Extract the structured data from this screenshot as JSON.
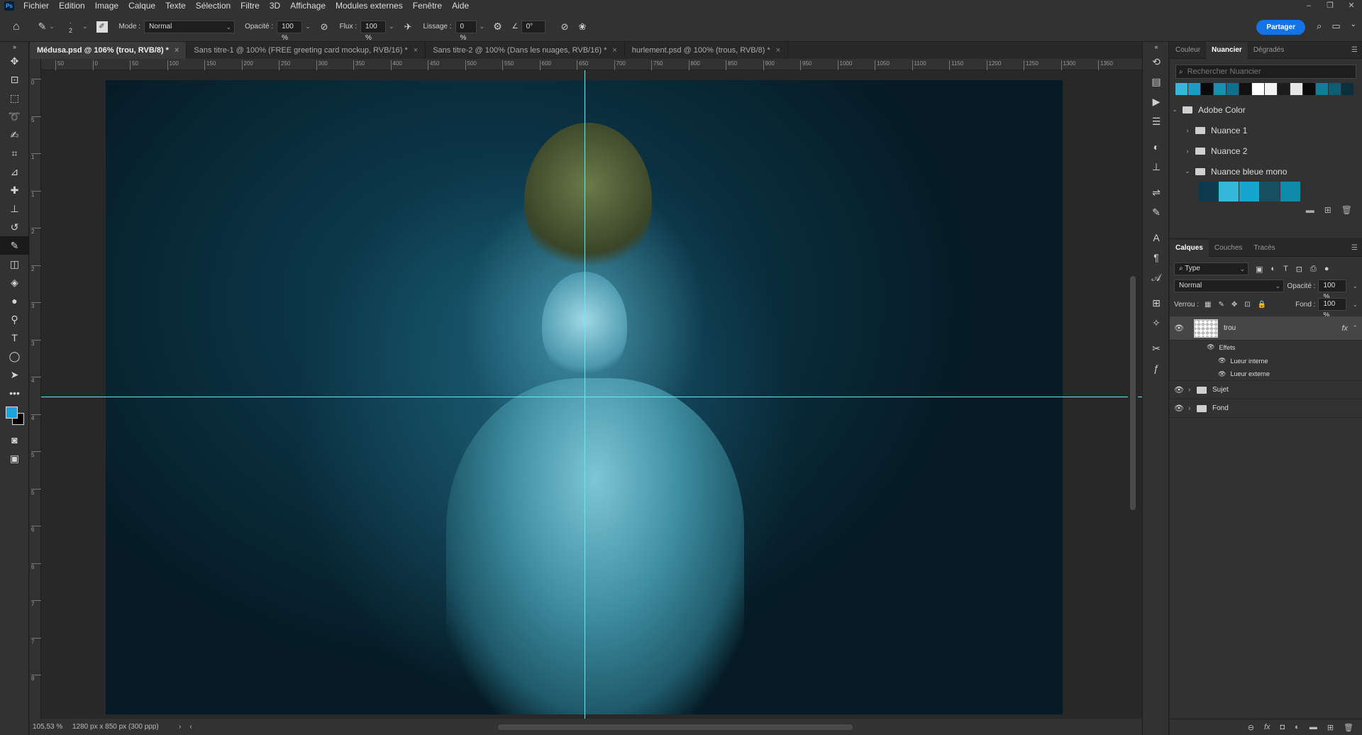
{
  "menu": [
    "Fichier",
    "Edition",
    "Image",
    "Calque",
    "Texte",
    "Sélection",
    "Filtre",
    "3D",
    "Affichage",
    "Modules externes",
    "Fenêtre",
    "Aide"
  ],
  "app_logo": "Ps",
  "options": {
    "brush_size": "2",
    "mode_label": "Mode :",
    "mode_value": "Normal",
    "opacity_label": "Opacité :",
    "opacity_value": "100 %",
    "flow_label": "Flux :",
    "flow_value": "100 %",
    "smoothing_label": "Lissage :",
    "smoothing_value": "0 %",
    "angle_value": "0°",
    "share_label": "Partager"
  },
  "tabs": [
    {
      "label": "Médusa.psd @ 106% (trou, RVB/8) *",
      "active": true
    },
    {
      "label": "Sans titre-1 @ 100% (FREE greeting card mockup, RVB/16) *",
      "active": false
    },
    {
      "label": "Sans titre-2 @ 100% (Dans les nuages, RVB/16) *",
      "active": false
    },
    {
      "label": "hurlement.psd @ 100% (trous, RVB/8) *",
      "active": false
    }
  ],
  "ruler_h": [
    "50",
    "0",
    "50",
    "100",
    "150",
    "200",
    "250",
    "300",
    "350",
    "400",
    "450",
    "500",
    "550",
    "600",
    "650",
    "700",
    "750",
    "800",
    "850",
    "900",
    "950",
    "1000",
    "1050",
    "1100",
    "1150",
    "1200",
    "1250",
    "1300",
    "1350"
  ],
  "ruler_v": [
    "0",
    "5",
    "1",
    "1",
    "2",
    "2",
    "3",
    "3",
    "4",
    "4",
    "5",
    "5",
    "6",
    "6",
    "7",
    "7",
    "8"
  ],
  "status": {
    "zoom": "105,53 %",
    "doc_info": "1280 px x 850 px (300 ppp)"
  },
  "swatch_panel": {
    "tabs": [
      "Couleur",
      "Nuancier",
      "Dégradés"
    ],
    "active_tab": "Nuancier",
    "search_placeholder": "Rechercher Nuancier",
    "recent_colors": [
      "#36b6d8",
      "#1c9cc4",
      "#0a0a0a",
      "#178fae",
      "#0f6f8c",
      "#111111",
      "#ffffff",
      "#f3f3f3",
      "#1c1c1c",
      "#e6e6e6",
      "#0b0b0b",
      "#137c96",
      "#0d5e72",
      "#0b2f3d"
    ],
    "groups": [
      {
        "label": "Adobe Color",
        "expanded": true,
        "level": 0
      },
      {
        "label": "Nuance 1",
        "expanded": false,
        "level": 1
      },
      {
        "label": "Nuance 2",
        "expanded": false,
        "level": 1
      },
      {
        "label": "Nuance bleue mono",
        "expanded": true,
        "level": 1
      }
    ],
    "mono_colors": [
      "#0c3a4c",
      "#33b8dc",
      "#15a6cf",
      "#184f5e",
      "#0f8aa8"
    ]
  },
  "layers_panel": {
    "tabs": [
      "Calques",
      "Couches",
      "Tracés"
    ],
    "active_tab": "Calques",
    "filter_value": "Type",
    "blend_value": "Normal",
    "opacity_label": "Opacité :",
    "opacity_value": "100 %",
    "lock_label": "Verrou :",
    "fill_label": "Fond :",
    "fill_value": "100 %",
    "layers": [
      {
        "name": "trou",
        "selected": true,
        "has_fx": true,
        "type": "pixel"
      },
      {
        "name": "Sujet",
        "selected": false,
        "has_fx": false,
        "type": "group"
      },
      {
        "name": "Fond",
        "selected": false,
        "has_fx": false,
        "type": "group"
      }
    ],
    "effects_label": "Effets",
    "effects": [
      "Lueur interne",
      "Lueur externe"
    ],
    "fx_label": "fx"
  }
}
